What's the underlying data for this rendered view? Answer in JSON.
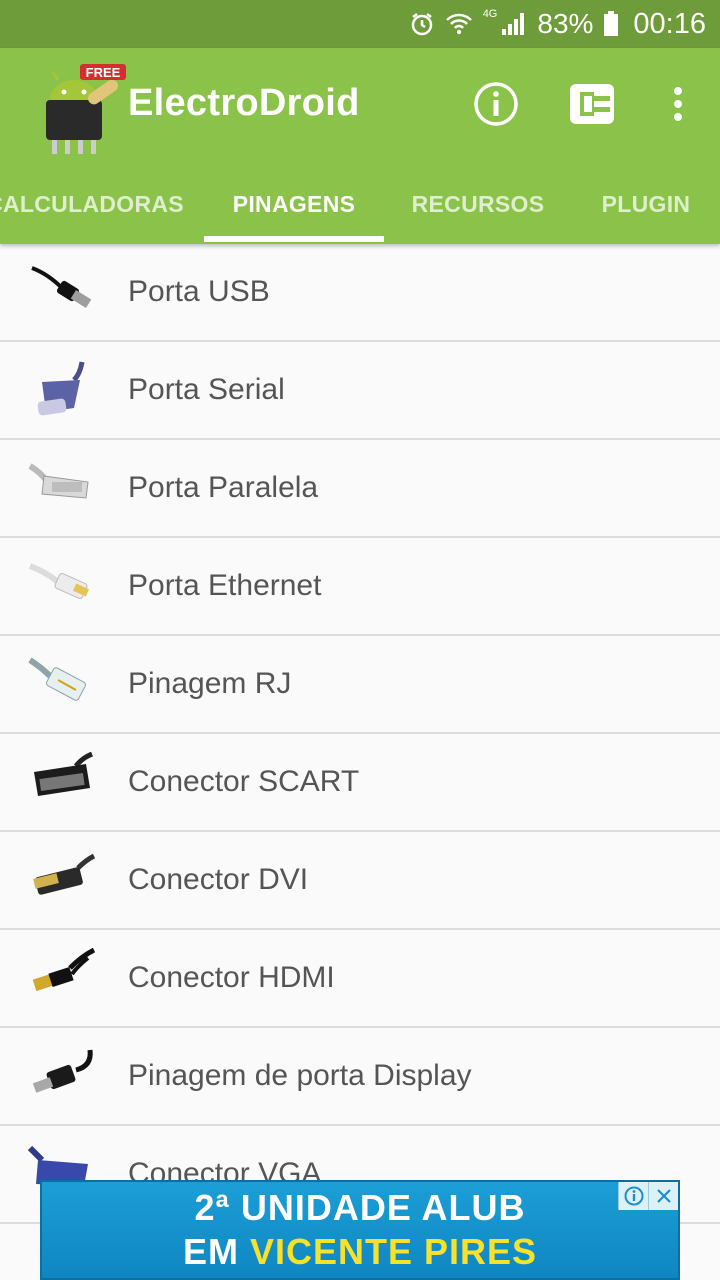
{
  "status_bar": {
    "network_label": "4G",
    "battery": "83%",
    "time": "00:16"
  },
  "app": {
    "title": "ElectroDroid",
    "logo_badge": "FREE",
    "colors": {
      "primary": "#8bc34a",
      "status_bar": "#6f9c3a"
    }
  },
  "tabs": [
    {
      "label": "CALCULADORAS",
      "active": false
    },
    {
      "label": "PINAGENS",
      "active": true
    },
    {
      "label": "RECURSOS",
      "active": false
    },
    {
      "label": "PLUGIN",
      "active": false
    }
  ],
  "items": [
    {
      "label": "Porta USB",
      "icon": "usb-cable-icon"
    },
    {
      "label": "Porta Serial",
      "icon": "serial-cable-icon"
    },
    {
      "label": "Porta Paralela",
      "icon": "parallel-cable-icon"
    },
    {
      "label": "Porta Ethernet",
      "icon": "ethernet-cable-icon"
    },
    {
      "label": "Pinagem RJ",
      "icon": "rj-cable-icon"
    },
    {
      "label": "Conector SCART",
      "icon": "scart-cable-icon"
    },
    {
      "label": "Conector DVI",
      "icon": "dvi-cable-icon"
    },
    {
      "label": "Conector HDMI",
      "icon": "hdmi-cable-icon"
    },
    {
      "label": "Pinagem de porta Display",
      "icon": "displayport-cable-icon"
    },
    {
      "label": "Conector VGA",
      "icon": "vga-cable-icon"
    }
  ],
  "ad": {
    "line1": "2ª UNIDADE ALUB",
    "line2_prefix": "EM ",
    "line2_highlight": "VICENTE PIRES"
  }
}
